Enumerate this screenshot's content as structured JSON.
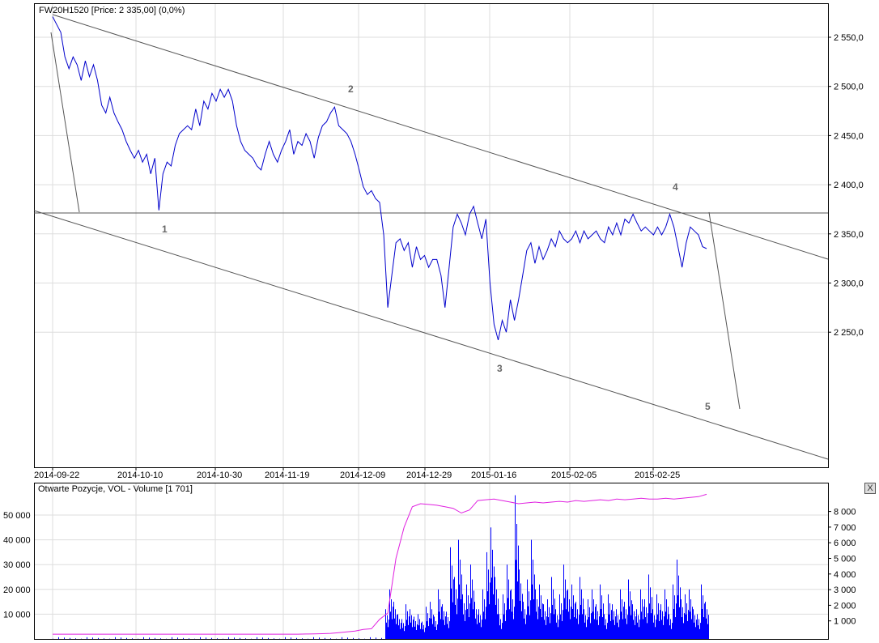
{
  "chart_data": [
    {
      "type": "line",
      "title": "FW20H1520 [Price: 2 335,00] (0,0%)",
      "x_ticks": [
        "2014-09-22",
        "2014-10-10",
        "2014-10-30",
        "2014-11-19",
        "2014-12-09",
        "2014-12-29",
        "2015-01-16",
        "2015-02-05",
        "2015-02-25"
      ],
      "y_ticks": [
        "2 550,0",
        "2 500,0",
        "2 450,0",
        "2 400,0",
        "2 350,0",
        "2 300,0",
        "2 250,0"
      ],
      "y_tick_values": [
        2550,
        2500,
        2450,
        2400,
        2350,
        2300,
        2250
      ],
      "ylim": [
        2165,
        2588
      ],
      "grid": true,
      "series": [
        {
          "name": "FW20H1520",
          "color": "#0000cc",
          "values": [
            2571,
            2563,
            2555,
            2530,
            2518,
            2530,
            2522,
            2506,
            2526,
            2510,
            2522,
            2506,
            2481,
            2473,
            2489,
            2473,
            2464,
            2456,
            2444,
            2435,
            2427,
            2435,
            2423,
            2431,
            2411,
            2427,
            2374,
            2411,
            2423,
            2419,
            2440,
            2452,
            2456,
            2460,
            2456,
            2477,
            2460,
            2485,
            2477,
            2493,
            2485,
            2497,
            2489,
            2497,
            2485,
            2460,
            2444,
            2435,
            2431,
            2427,
            2419,
            2415,
            2431,
            2444,
            2431,
            2423,
            2435,
            2444,
            2456,
            2431,
            2444,
            2440,
            2452,
            2444,
            2427,
            2448,
            2460,
            2464,
            2473,
            2479,
            2460,
            2456,
            2452,
            2444,
            2431,
            2415,
            2398,
            2390,
            2394,
            2386,
            2382,
            2349,
            2275,
            2308,
            2341,
            2345,
            2333,
            2341,
            2316,
            2337,
            2324,
            2328,
            2316,
            2324,
            2324,
            2308,
            2275,
            2316,
            2357,
            2370,
            2361,
            2349,
            2370,
            2378,
            2361,
            2345,
            2365,
            2300,
            2258,
            2242,
            2262,
            2250,
            2283,
            2262,
            2283,
            2308,
            2333,
            2341,
            2320,
            2337,
            2324,
            2333,
            2345,
            2337,
            2353,
            2345,
            2341,
            2345,
            2353,
            2341,
            2353,
            2345,
            2349,
            2353,
            2345,
            2341,
            2357,
            2349,
            2361,
            2349,
            2365,
            2361,
            2370,
            2361,
            2353,
            2357,
            2353,
            2349,
            2357,
            2349,
            2357,
            2370,
            2357,
            2337,
            2316,
            2341,
            2357,
            2353,
            2349,
            2337,
            2335
          ]
        }
      ],
      "annotations": {
        "wave_labels": [
          "1",
          "2",
          "3",
          "4",
          "5"
        ]
      }
    },
    {
      "type": "bar",
      "title": "Otwarte Pozycje, VOL - Volume [1 701]",
      "y_ticks_left": [
        "50 000",
        "40 000",
        "30 000",
        "20 000",
        "10 000"
      ],
      "y_tick_values_left": [
        50000,
        40000,
        30000,
        20000,
        10000
      ],
      "y_ticks_right": [
        "8 000",
        "7 000",
        "6 000",
        "5 000",
        "4 000",
        "3 000",
        "2 000",
        "1 000"
      ],
      "y_tick_values_right": [
        8000,
        7000,
        6000,
        5000,
        4000,
        3000,
        2000,
        1000
      ],
      "series": [
        {
          "name": "Volume",
          "color": "#0000ff",
          "values": [
            12000,
            20000,
            15000,
            10000,
            8000,
            14000,
            12000,
            9000,
            10000,
            7000,
            13000,
            15000,
            9000,
            20000,
            14000,
            11000,
            37000,
            25000,
            40000,
            18000,
            22000,
            30000,
            15000,
            12000,
            20000,
            35000,
            45000,
            25000,
            10000,
            18000,
            30000,
            20000,
            58000,
            28000,
            15000,
            24000,
            40000,
            20000,
            22000,
            14000,
            16000,
            25000,
            12000,
            18000,
            30000,
            20000,
            22000,
            15000,
            25000,
            12000,
            16000,
            20000,
            14000,
            22000,
            10000,
            18000,
            14000,
            12000,
            20000,
            15000,
            24000,
            14000,
            12000,
            20000,
            16000,
            26000,
            12000,
            18000,
            14000,
            20000,
            10000,
            22000,
            32000,
            16000,
            18000,
            20000,
            12000,
            10000,
            22000,
            15000
          ]
        },
        {
          "name": "Otwarte Pozycje",
          "color": "#e020e0",
          "values": [
            150,
            150,
            150,
            150,
            150,
            150,
            150,
            150,
            150,
            150,
            150,
            150,
            150,
            150,
            150,
            150,
            150,
            150,
            150,
            150,
            150,
            150,
            150,
            150,
            150,
            150,
            150,
            150,
            150,
            150,
            150,
            160,
            170,
            180,
            200,
            250,
            300,
            350,
            450,
            500,
            1100,
            1500,
            5000,
            7000,
            8300,
            8500,
            8450,
            8400,
            8300,
            8200,
            7900,
            8100,
            8700,
            8750,
            8800,
            8700,
            8600,
            8500,
            8550,
            8600,
            8550,
            8600,
            8650,
            8600,
            8700,
            8650,
            8700,
            8750,
            8700,
            8800,
            8750,
            8800,
            8850,
            8800,
            8800,
            8850,
            8800,
            8850,
            8900,
            8950,
            9100
          ]
        }
      ]
    }
  ],
  "ui": {
    "close_label": "X"
  }
}
